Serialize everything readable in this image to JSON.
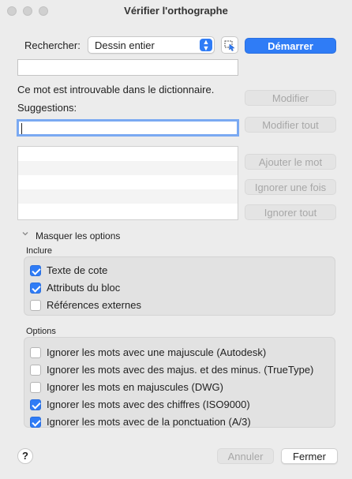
{
  "window": {
    "title": "Vérifier l'orthographe"
  },
  "search": {
    "label": "Rechercher:",
    "scope_value": "Dessin entier"
  },
  "buttons": {
    "start": "Démarrer",
    "modify": "Modifier",
    "modify_all": "Modifier tout",
    "add_word": "Ajouter le mot",
    "ignore_once": "Ignorer une fois",
    "ignore_all": "Ignorer tout",
    "cancel": "Annuler",
    "close": "Fermer",
    "help": "?"
  },
  "current_word": "",
  "message": "Ce mot est introuvable dans le dictionnaire.",
  "suggestions": {
    "label": "Suggestions:",
    "value": "",
    "items": []
  },
  "options_toggle": {
    "label": "Masquer les options",
    "icon": "chevron-down-icon"
  },
  "include": {
    "label": "Inclure",
    "items": [
      {
        "label": "Texte de cote",
        "checked": true
      },
      {
        "label": "Attributs du bloc",
        "checked": true
      },
      {
        "label": "Références externes",
        "checked": false
      }
    ]
  },
  "options": {
    "label": "Options",
    "items": [
      {
        "label": "Ignorer les mots avec une majuscule (Autodesk)",
        "checked": false
      },
      {
        "label": "Ignorer les mots avec des majus. et des minus. (TrueType)",
        "checked": false
      },
      {
        "label": "Ignorer les mots en majuscules (DWG)",
        "checked": false
      },
      {
        "label": "Ignorer les mots avec des chiffres (ISO9000)",
        "checked": true
      },
      {
        "label": "Ignorer les mots avec de la ponctuation (A/3)",
        "checked": true
      }
    ]
  },
  "colors": {
    "accent": "#2f7cf6",
    "window_bg": "#ececec",
    "group_bg": "#e2e2e2"
  }
}
